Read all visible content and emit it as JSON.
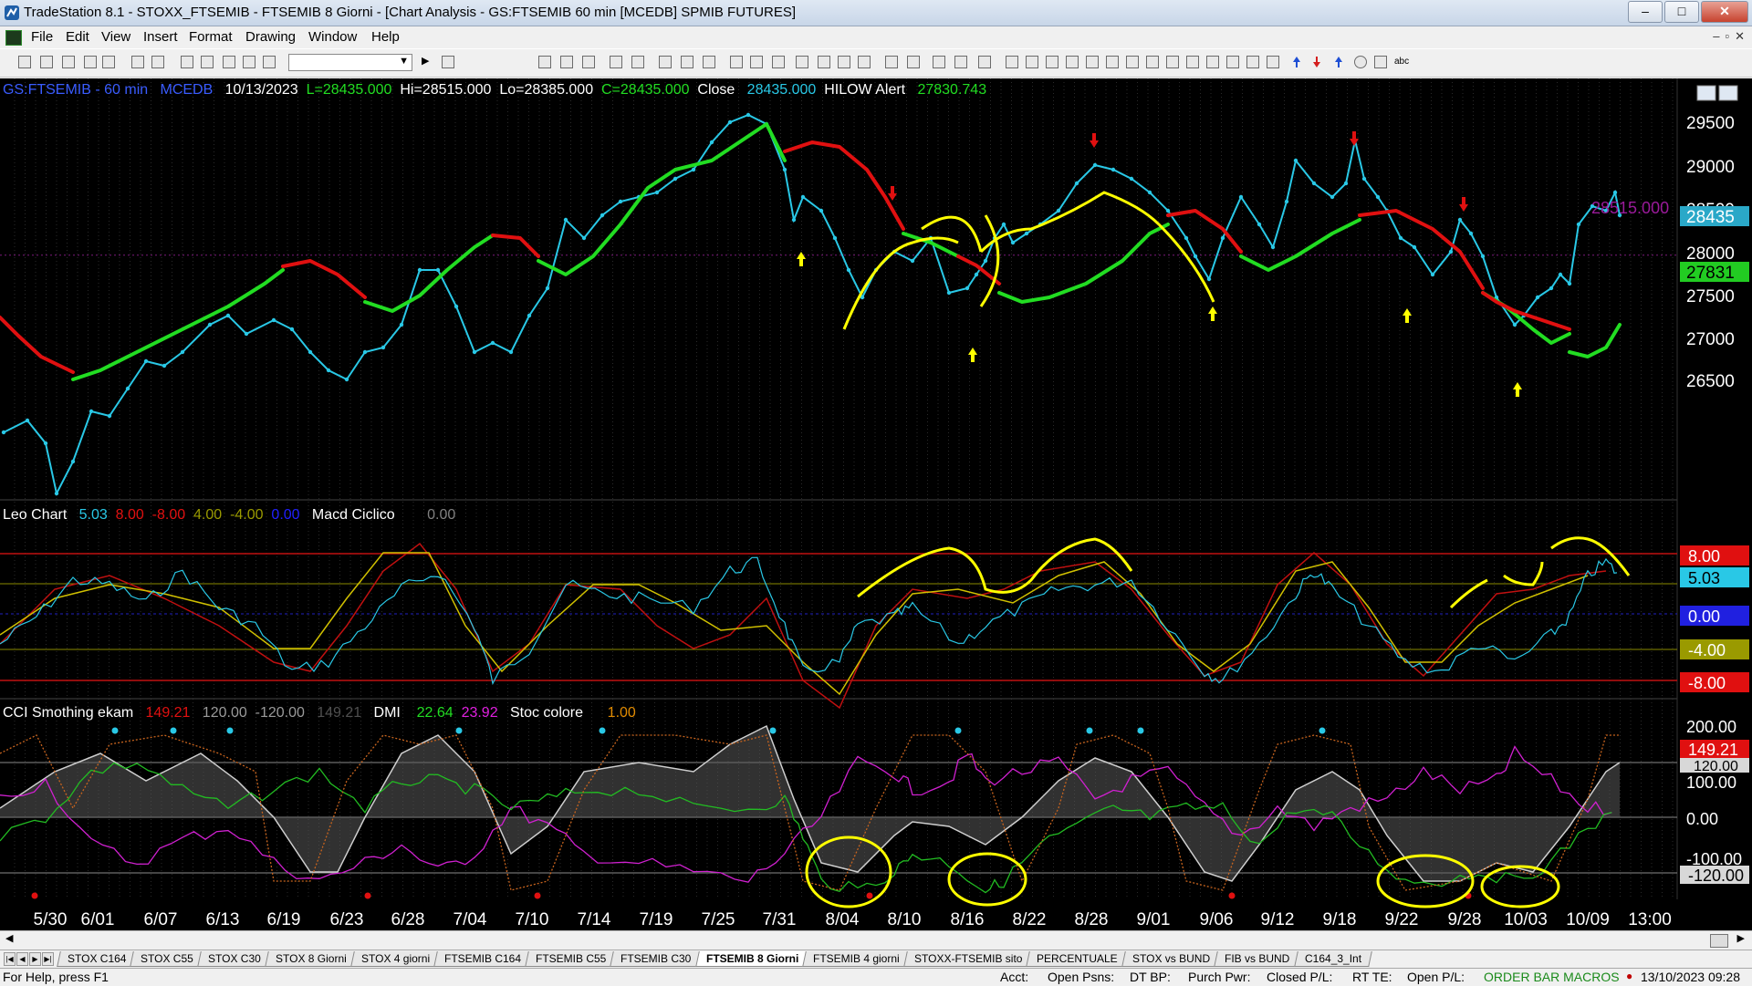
{
  "window": {
    "title": "TradeStation 8.1 - STOXX_FTSEMIB - FTSEMIB  8 Giorni - [Chart Analysis - GS:FTSEMIB  60 min  [MCEDB] SPMIB FUTURES]",
    "min": "‒",
    "max": "□",
    "close": "✕"
  },
  "menu": [
    "File",
    "Edit",
    "View",
    "Insert",
    "Format",
    "Drawing",
    "Window",
    "Help"
  ],
  "mdi": [
    "–",
    "▫",
    "✕"
  ],
  "chart": {
    "header": {
      "symbol": "GS:FTSEMIB - 60 min",
      "data2": "MCEDB",
      "date": "10/13/2023",
      "low_label": "L=28435.000",
      "hi": "Hi=28515.000",
      "lo": "Lo=28385.000",
      "close_val": "C=28435.000",
      "close_word": "Close",
      "close_num": "28435.000",
      "alert": "HILOW Alert",
      "alert_val": "27830.743"
    },
    "panel2": {
      "name": "Leo Chart",
      "v1": "5.03",
      "v2": "8.00",
      "v3": "-8.00",
      "v4": "4.00",
      "v5": "-4.00",
      "v6": "0.00",
      "macd": "Macd Ciclico",
      "macd_val": "0.00"
    },
    "panel3": {
      "name": "CCI Smothing ekam",
      "v1": "149.21",
      "v2": "120.00",
      "v3": "-120.00",
      "v4": "149.21",
      "dmi": "DMI",
      "dmi1": "22.64",
      "dmi2": "23.92",
      "stoc": "Stoc colore",
      "stoc_val": "1.00"
    },
    "price_axis": [
      "29500",
      "29000",
      "28500",
      "28000",
      "27500",
      "27000",
      "26500"
    ],
    "price_marks": {
      "level_text": "28515.000",
      "last": "28435",
      "alert": "27831"
    },
    "panel2_axis": {
      "p8": "8.00",
      "val": "5.03",
      "zero": "0.00",
      "m4": "-4.00",
      "m8": "-8.00",
      "half": "4.00"
    },
    "panel3_axis": {
      "p200": "200.00",
      "val": "149.21",
      "p120": "120.00",
      "p100": "100.00",
      "zero": "0.00",
      "m100": "-100.00",
      "m120": "-120.00"
    },
    "dates": [
      "5/30",
      "6/01",
      "6/07",
      "6/13",
      "6/19",
      "6/23",
      "6/28",
      "7/04",
      "7/10",
      "7/14",
      "7/19",
      "7/25",
      "7/31",
      "8/04",
      "8/10",
      "8/16",
      "8/22",
      "8/28",
      "9/01",
      "9/06",
      "9/12",
      "9/18",
      "9/22",
      "9/28",
      "10/03",
      "10/09",
      "13:00"
    ],
    "colors": {
      "price": "#29c8e6",
      "up": "#22dd22",
      "down": "#e01010",
      "annot": "#ffff00",
      "bg": "#000000"
    }
  },
  "tabs": [
    "STOX C164",
    "STOX C55",
    "STOX  C30",
    "STOX  8 Giorni",
    "STOX 4 giorni",
    "FTSEMIB C164",
    "FTSEMIB C55",
    "FTSEMIB C30",
    "FTSEMIB  8 Giorni",
    "FTSEMIB  4 giorni",
    "STOXX-FTSEMIB sito",
    "PERCENTUALE",
    "STOX vs BUND",
    "FIB vs BUND",
    "C164_3_Int"
  ],
  "active_tab": 8,
  "status": {
    "help": "For Help, press F1",
    "acct": "Acct:",
    "open_psns": "Open Psns:",
    "dt_bp": "DT BP:",
    "purch": "Purch Pwr:",
    "closed_pl": "Closed P/L:",
    "rt_te": "RT TE:",
    "open_pl": "Open P/L:",
    "macros": "ORDER BAR  MACROS",
    "datetime": "13/10/2023 09:28"
  }
}
